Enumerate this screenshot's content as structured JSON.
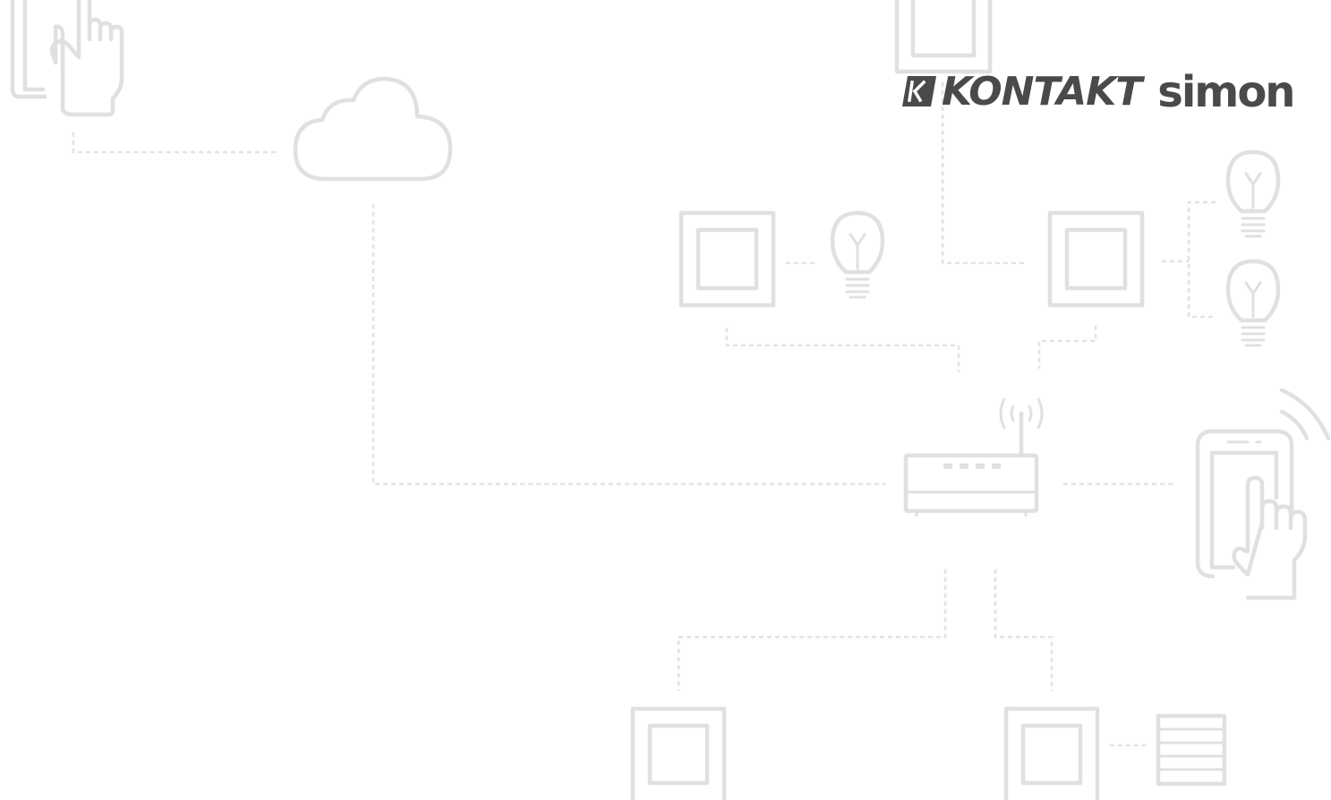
{
  "brand": {
    "kontakt": "KONTAKT",
    "simon": "simon",
    "mark_color": "#4a4a4a",
    "text_color": "#4a4a4a"
  },
  "diagram": {
    "line_color": "#e3e3e3",
    "icon_color": "#e0e0e0",
    "background": "#ffffff",
    "nodes": [
      {
        "id": "hand-tablet-top-left",
        "icon": "hand-touch-icon"
      },
      {
        "id": "cloud",
        "icon": "cloud-icon"
      },
      {
        "id": "switch-top-center",
        "icon": "switch-icon"
      },
      {
        "id": "switch-mid-left",
        "icon": "switch-icon"
      },
      {
        "id": "bulb-mid-left",
        "icon": "bulb-icon"
      },
      {
        "id": "switch-mid-right",
        "icon": "switch-icon"
      },
      {
        "id": "bulb-right-top",
        "icon": "bulb-icon"
      },
      {
        "id": "bulb-right-bottom",
        "icon": "bulb-icon"
      },
      {
        "id": "router",
        "icon": "router-icon"
      },
      {
        "id": "smartphone",
        "icon": "smartphone-touch-icon"
      },
      {
        "id": "switch-bottom-left",
        "icon": "switch-icon"
      },
      {
        "id": "switch-bottom-right",
        "icon": "switch-icon"
      },
      {
        "id": "blind",
        "icon": "blind-icon"
      }
    ]
  }
}
